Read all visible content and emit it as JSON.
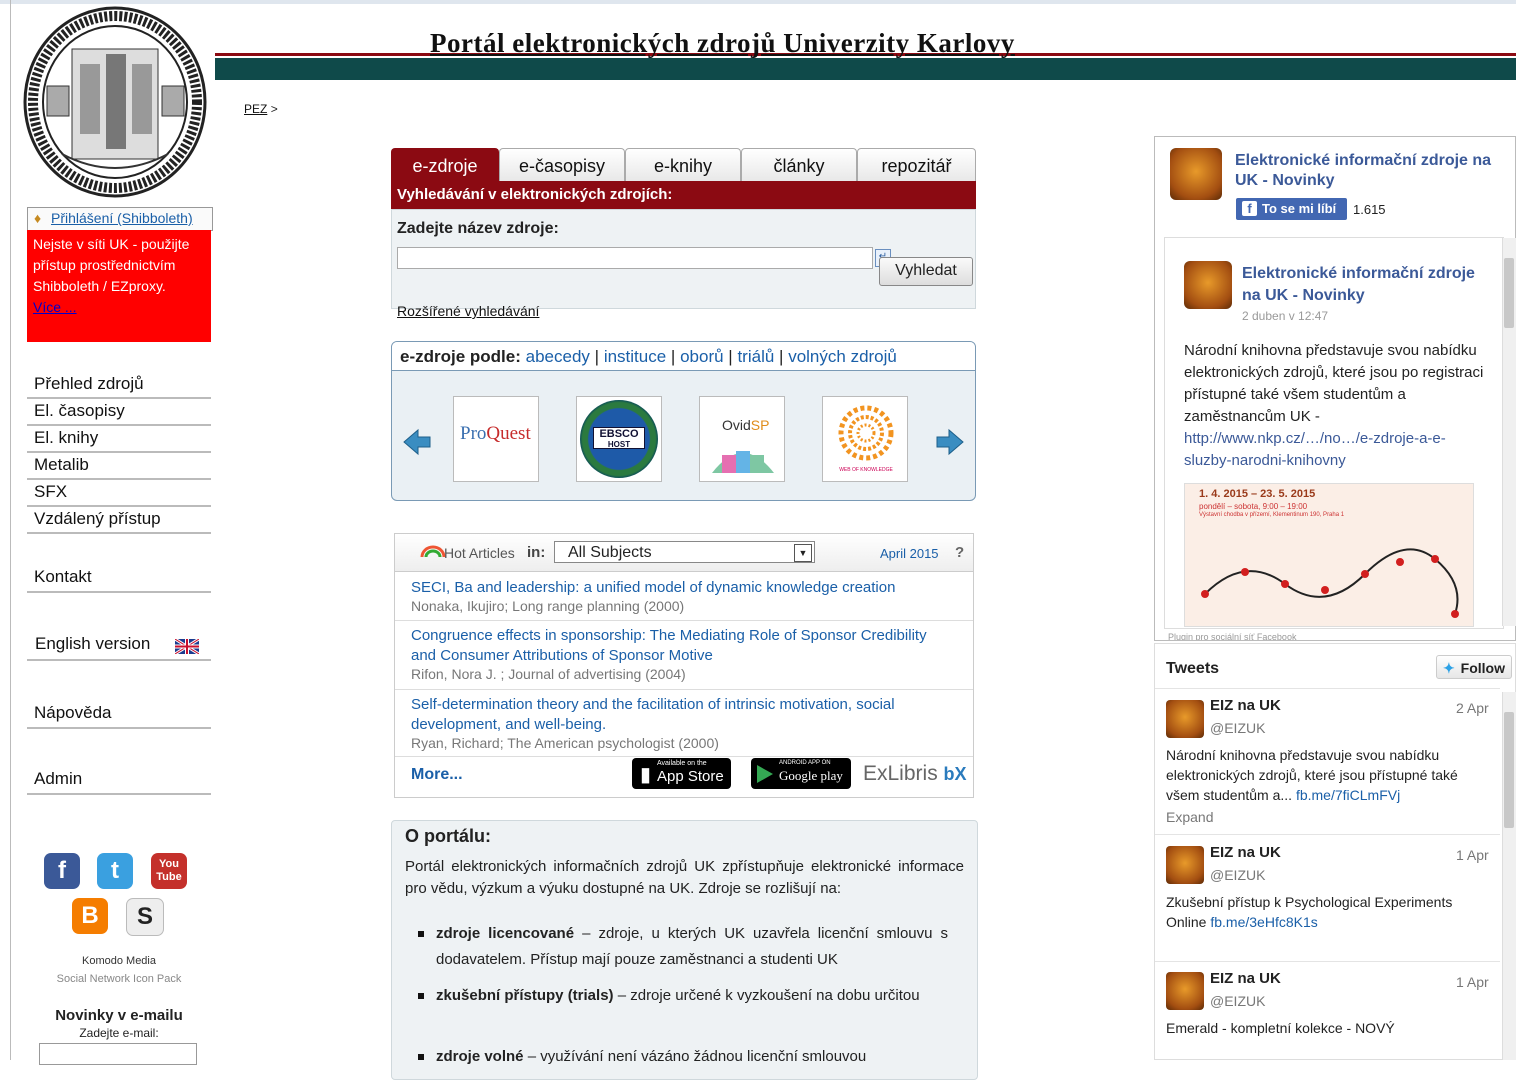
{
  "header": {
    "title": "Portál elektronických zdrojů Univerzity Karlovy"
  },
  "sidebar": {
    "login": "Přihlášení (Shibboleth)",
    "warning": "Nejste v síti UK - použijte přístup prostřednictvím Shibboleth / EZproxy.",
    "warning_more": "Více ...",
    "nav": [
      "Přehled zdrojů",
      "El. časopisy",
      "El. knihy",
      "Metalib",
      "SFX",
      "Vzdálený přístup"
    ],
    "contact": "Kontakt",
    "english": "English version",
    "help": "Nápověda",
    "admin": "Admin",
    "social_credit_1": "Komodo Media",
    "social_credit_2": "Social Network Icon Pack",
    "newsletter_title": "Novinky v e-mailu",
    "newsletter_label": "Zadejte e-mail:",
    "social_icons": [
      "facebook-icon",
      "twitter-icon",
      "youtube-icon",
      "blogger-icon",
      "scribd-icon"
    ],
    "youtube_top": "You",
    "youtube_bottom": "Tube"
  },
  "breadcrumb": {
    "root": "PEZ",
    "sep": ">"
  },
  "search": {
    "tabs": [
      "e-zdroje",
      "e-časopisy",
      "e-knihy",
      "články",
      "repozitář"
    ],
    "active_tab": "e-zdroje",
    "bar": "Vyhledávání v elektronických zdrojích:",
    "label": "Zadejte název zdroje:",
    "input_value": "",
    "button": "Vyhledat",
    "advanced": "Rozšířené vyhledávání"
  },
  "browse": {
    "label": "e-zdroje podle:",
    "links": [
      "abecedy",
      "instituce",
      "oborů",
      "triálů",
      "volných zdrojů"
    ],
    "sep": "|",
    "logos": [
      "ProQuest",
      "EBSCO HOST",
      "OvidSP",
      "WEB OF KNOWLEDGE"
    ],
    "ovid_prefix": "Ovid",
    "ovid_suffix": "SP",
    "proquest_pro": "Pro",
    "proquest_quest": "Quest",
    "ebsco_top": "EBSCO",
    "ebsco_bottom": "HOST",
    "wok_small": "WEB OF KNOWLEDGE"
  },
  "hot_articles": {
    "title": "Hot Articles",
    "in": "in:",
    "subject": "All Subjects",
    "month": "April 2015",
    "help": "?",
    "articles": [
      {
        "title": "SECI, Ba and leadership: a unified model of dynamic knowledge creation",
        "meta": "Nonaka, Ikujiro; Long range planning (2000)"
      },
      {
        "title_1": "Congruence effects in sponsorship: The Mediating Role of Sponsor Credibility",
        "title_2": "and Consumer Attributions of Sponsor Motive",
        "meta": "Rifon, Nora J. ; Journal of advertising (2004)"
      },
      {
        "title_1": "Self-determination theory and the facilitation of intrinsic motivation, social",
        "title_2": "development, and well-being.",
        "meta": "Ryan, Richard; The American psychologist (2000)"
      }
    ],
    "more": "More...",
    "appstore_small": "Available on the",
    "appstore": "App Store",
    "googleplay_small": "ANDROID APP ON",
    "googleplay": "Google play",
    "exlibris": "ExLibris",
    "bx": "bX"
  },
  "about": {
    "title": "O portálu:",
    "intro": "Portál elektronických informačních zdrojů UK zpřístupňuje elektronické informace pro vědu, výzkum a výuku dostupné na UK. Zdroje se rozlišují na:",
    "items": [
      {
        "term": "zdroje licencované",
        "text": " – zdroje, u kterých UK uzavřela licenční smlouvu s dodavatelem. Přístup mají pouze zaměstnanci a studenti UK"
      },
      {
        "term": "zkušební přístupy (trials)",
        "text": " – zdroje určené k vyzkoušení na dobu určitou"
      },
      {
        "term": "zdroje volné",
        "text": " – využívání není vázáno žádnou licenční smlouvou"
      }
    ]
  },
  "facebook": {
    "page_title": "Elektronické informační zdroje na UK - Novinky",
    "like": "To se mi líbí",
    "likes": "1.615",
    "post_title": "Elektronické informační zdroje na UK - Novinky",
    "post_date": "2 duben v 12:47",
    "post_text": "Národní knihovna představuje svou nabídku elektronických zdrojů, které jsou po registraci přístupné také všem studentům a zaměstnancům UK -",
    "post_link": "http://www.nkp.cz/…/no…/e-zdroje-a-e-sluzby-narodni-knihovny",
    "img_dates": "1. 4. 2015 – 23. 5. 2015",
    "img_hours": "pondělí – sobota, 9:00 – 19:00",
    "img_place": "Výstavní chodba v přízemí, Klementinum 190, Praha 1",
    "footer": "Plugin pro sociální síť Facebook"
  },
  "tweets": {
    "title": "Tweets",
    "follow": "Follow",
    "items": [
      {
        "name": "EIZ na UK",
        "handle": "@EIZUK",
        "date": "2 Apr",
        "text": "Národní knihovna představuje svou nabídku elektronických zdrojů, které jsou přístupné také všem studentům a...",
        "link": "fb.me/7fiCLmFVj",
        "expand": "Expand"
      },
      {
        "name": "EIZ na UK",
        "handle": "@EIZUK",
        "date": "1 Apr",
        "text": "Zkušební přístup k Psychological Experiments Online",
        "link": "fb.me/3eHfc8K1s"
      },
      {
        "name": "EIZ na UK",
        "handle": "@EIZUK",
        "date": "1 Apr",
        "text": "Emerald - kompletní kolekce - NOVÝ"
      }
    ]
  },
  "colors": {
    "brand": "#8b0a12",
    "band": "#0f4a4a",
    "link": "#1a5fa8",
    "warning": "#ff0000",
    "facebook": "#4267b2"
  }
}
